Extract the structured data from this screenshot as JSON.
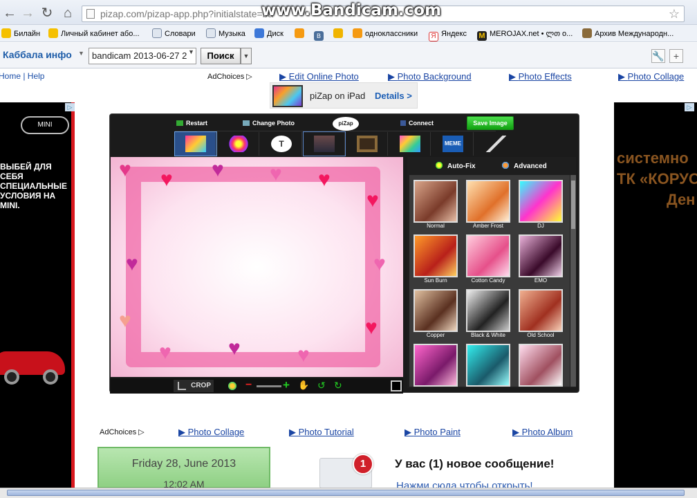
{
  "browser": {
    "url": "pizap.com/pizap-app.php?initialstate=ba",
    "watermark": "www.Bandicam.com",
    "bookmarks": [
      "Билайн",
      "Личный кабинет або...",
      "Словари",
      "Музыка",
      "Диск",
      "",
      "В",
      "",
      "одноклассники",
      "Яндекс",
      "MEROJAX.net • ლთ о...",
      "Архив Международн..."
    ]
  },
  "toolbar": {
    "brand": "Каббала инфо",
    "search_value": "bandicam 2013-06-27 2",
    "search_button": "Поиск"
  },
  "page": {
    "header_links": "Home | Help",
    "adchoices": "AdChoices",
    "top_links": [
      "Edit Online Photo",
      "Photo Background",
      "Photo Effects",
      "Photo Collage"
    ],
    "ipad": {
      "text": "piZap on iPad",
      "details": "Details >"
    },
    "bottom_links": [
      "Photo Collage",
      "Photo Tutorial",
      "Photo Paint",
      "Photo Album"
    ],
    "date": "Friday 28, June 2013",
    "time": "12:02 AM",
    "badge": "1",
    "message": "У вас (1) новое сообщение!",
    "message_link": "Нажми сюда чтобы открыть!"
  },
  "left_ad": {
    "logo": "MINI",
    "text": "ВЫБЕЙ ДЛЯ СЕБЯ СПЕЦИАЛЬНЫЕ УСЛОВИЯ НА MINI."
  },
  "right_ad": {
    "lines": [
      "системно",
      "ТК «КОРУС",
      "Ден"
    ]
  },
  "app": {
    "restart": "Restart",
    "change_photo": "Change Photo",
    "logo": "piZap",
    "connect": "Connect",
    "save": "Save Image",
    "crop": "CROP",
    "autofix": "Auto-Fix",
    "advanced": "Advanced",
    "effects": [
      "Normal",
      "Amber Frost",
      "DJ",
      "Sun Burn",
      "Cotton Candy",
      "EMO",
      "Copper",
      "Black & White",
      "Old School",
      "",
      "",
      ""
    ]
  }
}
